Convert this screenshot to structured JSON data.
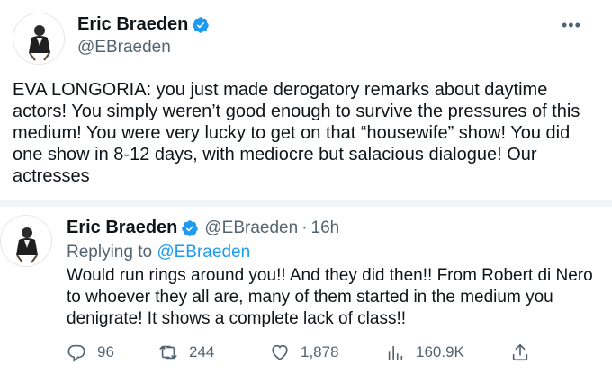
{
  "tweet": {
    "author": {
      "name": "Eric Braeden",
      "handle": "@EBraeden"
    },
    "more_label": "•••",
    "text": "EVA LONGORIA: you just made derogatory remarks about daytime actors! You simply weren’t good enough to survive the pressures of this medium! You were very lucky to get on that “housewife” show! You did one show in 8-12 days, with mediocre but  salacious dialogue! Our actresses"
  },
  "reply": {
    "author": {
      "name": "Eric Braeden",
      "handle": "@EBraeden"
    },
    "separator": "·",
    "time": "16h",
    "replying_prefix": "Replying to ",
    "replying_to": "@EBraeden",
    "text": "Would run rings around you!! And they did then!! From Robert di Nero to whoever they all are, many of them started in the medium you denigrate! It shows a complete lack of class!!",
    "metrics": {
      "replies": "96",
      "retweets": "244",
      "likes": "1,878",
      "views": "160.9K"
    }
  },
  "colors": {
    "text": "#0f1419",
    "secondary": "#536471",
    "accent": "#1d9bf0",
    "divider": "#f3f4f5"
  },
  "icons": [
    "verified-badge-icon",
    "more-icon",
    "reply-icon",
    "retweet-icon",
    "like-icon",
    "views-icon",
    "share-icon"
  ]
}
